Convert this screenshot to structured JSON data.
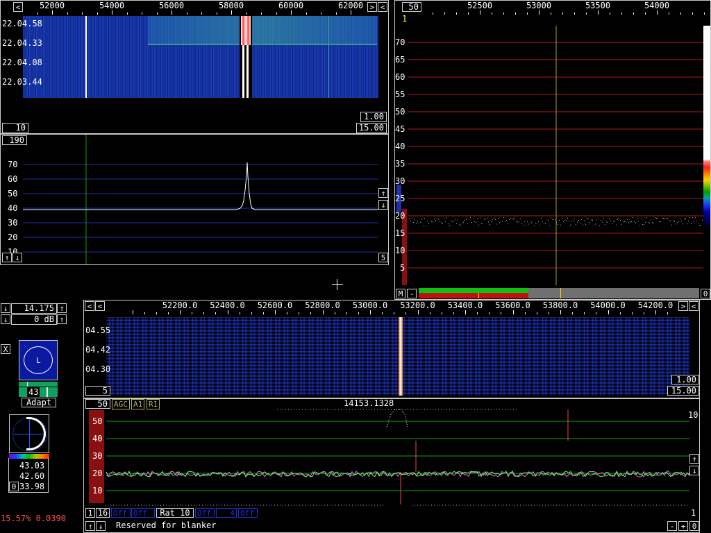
{
  "waterfall_main": {
    "freq_labels": [
      "52000",
      "54000",
      "56000",
      "58000",
      "60000",
      "62000"
    ],
    "time_labels": [
      "22.04.58",
      "22.04.33",
      "22.04.08",
      "22.03.44"
    ],
    "gain": "1.00",
    "speed": "15.00",
    "avg": "10"
  },
  "spectrum_main": {
    "avg_box": "190",
    "y_labels": [
      "70",
      "60",
      "50",
      "40",
      "30",
      "20",
      "10"
    ],
    "right_box": "5"
  },
  "hires_panel": {
    "avg_box": "50",
    "freq_labels": [
      "52500",
      "53000",
      "53500",
      "54000"
    ],
    "marker": "1",
    "y_labels": [
      "70",
      "65",
      "60",
      "55",
      "50",
      "45",
      "40",
      "35",
      "30",
      "25",
      "20",
      "15",
      "10",
      "5"
    ],
    "m_button": "M",
    "minus_button": "-",
    "zero_box": "0"
  },
  "bfo_controls": {
    "freq": "14.175",
    "gain": "0 dB"
  },
  "agc_panel": {
    "x_button": "X",
    "circle_label": "L",
    "level": "43",
    "adapt_button": "Adapt"
  },
  "meter_panel": {
    "val1": "43.03",
    "val2": "42.60",
    "val3": "33.98",
    "zero": "0"
  },
  "status": {
    "cpu_text": "15.57% 0.0390"
  },
  "baseband": {
    "freq_labels": [
      "52200.0",
      "52400.0",
      "52600.0",
      "52800.0",
      "53000.0",
      "53200.0",
      "53400.0",
      "53600.0",
      "53800.0",
      "54000.0",
      "54200.0"
    ],
    "time_labels": [
      "04.55",
      "04.42",
      "04.30"
    ],
    "avg": "5",
    "gain": "1.00",
    "speed": "15.00"
  },
  "baseband_spectrum": {
    "avg_box": "50",
    "agc_tag": "AGC",
    "a1_tag": "A1",
    "r1_tag": "R1",
    "freq_readout": "14153.1328",
    "y_labels": [
      "50",
      "40",
      "30",
      "20",
      "10"
    ],
    "right_label": "10"
  },
  "bottom_bar": {
    "b1": "1",
    "b16": "16",
    "off1": "Off",
    "off2": "Off",
    "rat": "Rat 10",
    "off3": "Off",
    "four": "4",
    "off4": "Off",
    "blanker_text": "Reserved for blanker",
    "right_one": "1",
    "minus": "-",
    "plus": "+",
    "zero": "0"
  },
  "colors": {
    "waterfall_blue": "#0a2a9a",
    "grid_blue": "#2030b0",
    "grid_red": "#b01818",
    "grid_green": "#10a010",
    "accent_green": "#10c010",
    "tag_olive": "#b0b060"
  }
}
